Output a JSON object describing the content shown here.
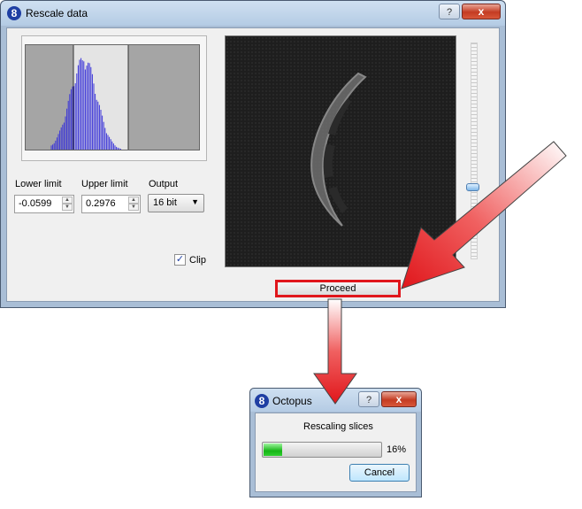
{
  "main_window": {
    "title": "Rescale data",
    "help_label": "?",
    "close_label": "x",
    "lower_limit_label": "Lower limit",
    "lower_limit_value": "-0.0599",
    "upper_limit_label": "Upper limit",
    "upper_limit_value": "0.2976",
    "output_label": "Output",
    "output_value": "16 bit",
    "clip_label": "Clip",
    "clip_checked": true,
    "proceed_label": "Proceed",
    "highlight_color": "#e0161b"
  },
  "progress_dialog": {
    "title": "Octopus",
    "help_label": "?",
    "close_label": "x",
    "status_text": "Rescaling slices",
    "progress_text": "16%",
    "progress_value": 0.16,
    "cancel_label": "Cancel"
  },
  "icons": {
    "app_icon_glyph": "8"
  }
}
